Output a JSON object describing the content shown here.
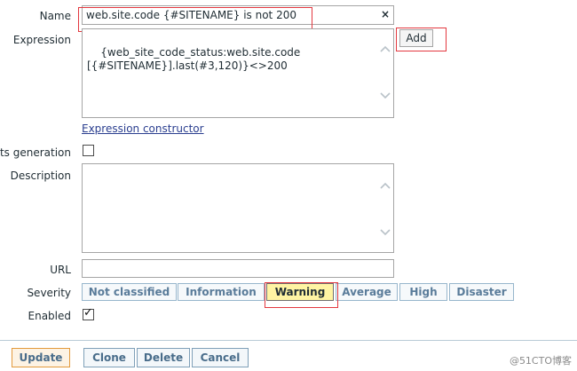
{
  "form": {
    "name_label": "Name",
    "name_value": "web.site.code {#SITENAME} is not 200",
    "clear_glyph": "×",
    "expression_label": "Expression",
    "expression_value": "{web_site_code_status:web.site.code\n[{#SITENAME}].last(#3,120)}<>200",
    "add_label": "Add",
    "expression_constructor_link": "Expression constructor",
    "events_generation_label": "nts generation",
    "events_generation_checked": false,
    "description_label": "Description",
    "description_value": "",
    "url_label": "URL",
    "url_value": "",
    "severity_label": "Severity",
    "severity_options": [
      "Not classified",
      "Information",
      "Warning",
      "Average",
      "High",
      "Disaster"
    ],
    "severity_selected": "Warning",
    "enabled_label": "Enabled",
    "enabled_checked": true,
    "check_glyph": "✓"
  },
  "footer": {
    "update_label": "Update",
    "clone_label": "Clone",
    "delete_label": "Delete",
    "cancel_label": "Cancel"
  },
  "watermark": "@51CTO博客",
  "colors": {
    "highlight_red": "#e3383f",
    "selected_severity": "#fff4a3",
    "link": "#2a3e8f",
    "primary_border": "#e39a3c"
  }
}
